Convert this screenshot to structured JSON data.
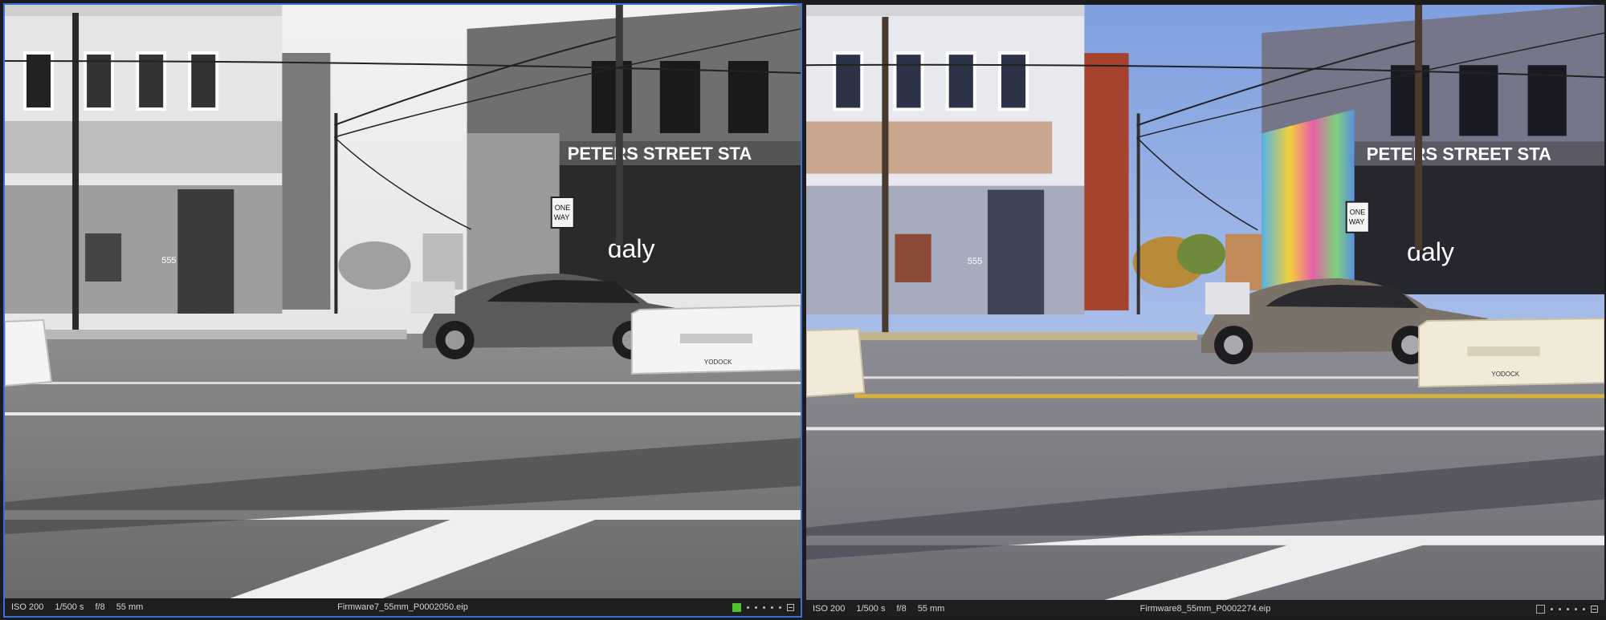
{
  "viewers": [
    {
      "mode": "monochrome",
      "selected": true,
      "iso": "ISO 200",
      "shutter": "1/500 s",
      "aperture": "f/8",
      "focal_length": "55 mm",
      "filename": "Firmware7_55mm_P0002050.eip",
      "color_label": "green",
      "rating_dots": 5,
      "sign_text": "PETERS STREET STA",
      "one_way_top": "ONE",
      "one_way_bottom": "WAY",
      "store_text": "daly",
      "address": "555",
      "barrier_text": "YODOCK"
    },
    {
      "mode": "color",
      "selected": false,
      "iso": "ISO 200",
      "shutter": "1/500 s",
      "aperture": "f/8",
      "focal_length": "55 mm",
      "filename": "Firmware8_55mm_P0002274.eip",
      "color_label": "none",
      "rating_dots": 5,
      "sign_text": "PETERS STREET STA",
      "one_way_top": "ONE",
      "one_way_bottom": "WAY",
      "store_text": "daly",
      "address": "555",
      "barrier_text": "YODOCK"
    }
  ],
  "colors": {
    "selection_border": "#3a6fd8",
    "green_label": "#4fbf2a",
    "sky_color": "#9fb6e6",
    "sky_mono": "#eeeeee",
    "brick_color": "#a5432f",
    "yellow_line": "#d8b23a"
  }
}
